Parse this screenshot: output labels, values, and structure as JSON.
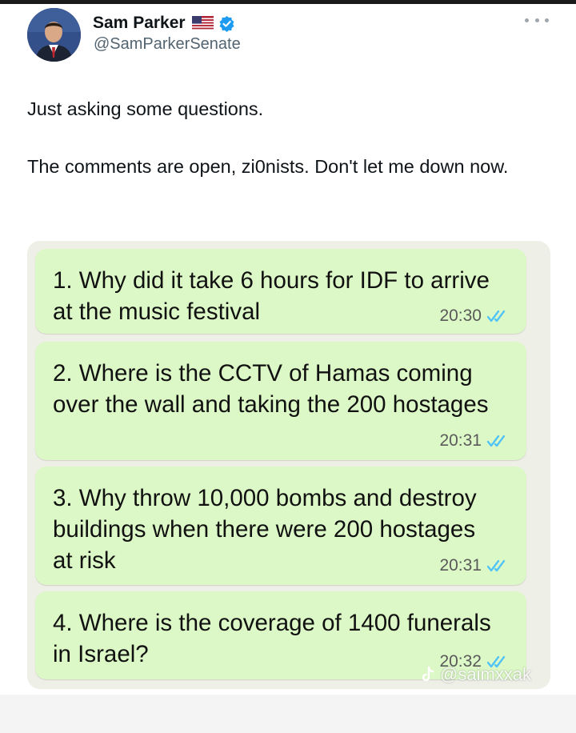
{
  "author": {
    "name": "Sam Parker",
    "handle": "@SamParkerSenate",
    "flag_icon": "us-flag-icon",
    "verified_icon": "verified-badge-icon"
  },
  "tweet": {
    "lines": [
      "Just asking some questions.",
      "The comments are open, zi0nists. Don't let me down now."
    ]
  },
  "chat": {
    "bubble_color": "#dcf8c6",
    "tick_color": "#4fc3f7",
    "messages": [
      {
        "text": "1. Why did it take 6 hours for IDF to arrive at the music festival",
        "time": "20:30"
      },
      {
        "text": "2. Where is the CCTV of Hamas coming over the wall and taking the 200 hostages",
        "time": "20:31"
      },
      {
        "text": "3. Why throw 10,000 bombs and destroy buildings when there were 200 hostages at risk",
        "time": "20:31"
      },
      {
        "text": "4. Where is the coverage of 1400 funerals in Israel?",
        "time": "20:32"
      }
    ]
  },
  "watermark": {
    "text": "@saimxxak",
    "icon": "tiktok-icon"
  }
}
